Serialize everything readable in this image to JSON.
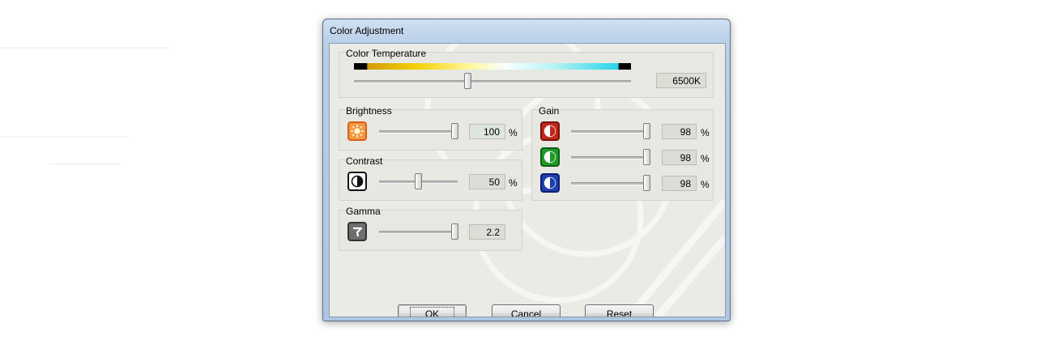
{
  "dialog": {
    "title": "Color Adjustment"
  },
  "color_temperature": {
    "label": "Color Temperature",
    "value": "6500K",
    "slider_position": 0.41
  },
  "brightness": {
    "label": "Brightness",
    "value": "100",
    "unit": "%",
    "slider_position": 0.96,
    "icon": "sun-icon"
  },
  "contrast": {
    "label": "Contrast",
    "value": "50",
    "unit": "%",
    "slider_position": 0.5,
    "icon": "contrast-icon"
  },
  "gamma": {
    "label": "Gamma",
    "value": "2.2",
    "slider_position": 0.96,
    "icon": "gamma-icon"
  },
  "gain": {
    "label": "Gain",
    "channels": [
      {
        "name": "red",
        "value": "98",
        "unit": "%",
        "slider_position": 0.96,
        "color": "#c0281c"
      },
      {
        "name": "green",
        "value": "98",
        "unit": "%",
        "slider_position": 0.96,
        "color": "#1f9a2a"
      },
      {
        "name": "blue",
        "value": "98",
        "unit": "%",
        "slider_position": 0.96,
        "color": "#1f3fb0"
      }
    ]
  },
  "buttons": {
    "ok": "OK",
    "cancel": "Cancel",
    "reset_first": "R",
    "reset_rest": "eset"
  },
  "colors": {
    "brightness_icon": "#e8731e",
    "titlebar": "#b9cfe8",
    "client_bg": "#ebebe6"
  }
}
